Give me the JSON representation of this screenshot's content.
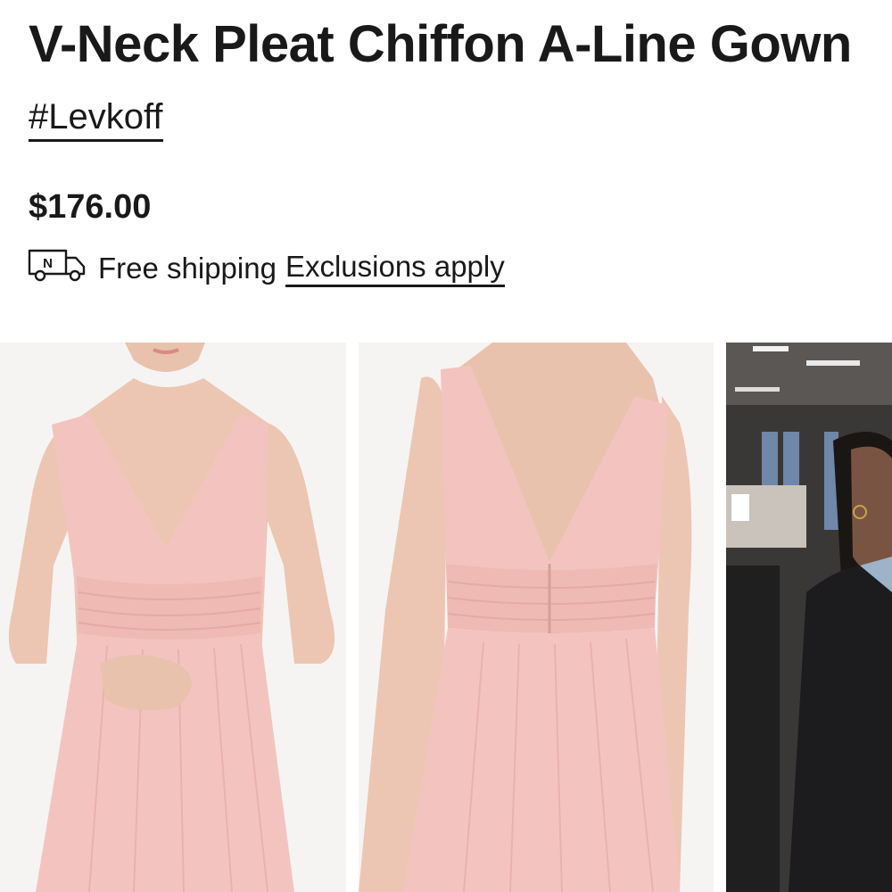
{
  "product": {
    "title": "V-Neck Pleat Chiffon A-Line Gown",
    "brand": "#Levkoff",
    "price": "$176.00"
  },
  "shipping": {
    "icon": "delivery-truck-icon",
    "truck_badge": "N",
    "text": "Free shipping",
    "exclusions_link": "Exclusions apply"
  },
  "gallery": {
    "images": [
      {
        "name": "front-view",
        "subject": "blush pink chiffon gown, front"
      },
      {
        "name": "back-view",
        "subject": "blush pink chiffon gown, back"
      },
      {
        "name": "video-thumbnail",
        "subject": "woman in black blazer in store"
      }
    ]
  },
  "colors": {
    "text": "#191919",
    "dress": "#f3c4bf",
    "background": "#ffffff"
  }
}
